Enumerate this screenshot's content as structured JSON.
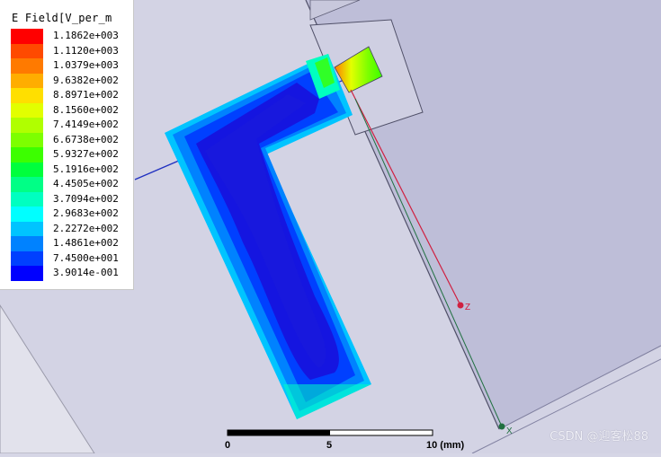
{
  "legend": {
    "title": "E Field[V_per_m",
    "entries": [
      {
        "label": "1.1862e+003",
        "color": "#ff0000"
      },
      {
        "label": "1.1120e+003",
        "color": "#ff4a00"
      },
      {
        "label": "1.0379e+003",
        "color": "#ff7a00"
      },
      {
        "label": "9.6382e+002",
        "color": "#ffad00"
      },
      {
        "label": "8.8971e+002",
        "color": "#ffdf00"
      },
      {
        "label": "8.1560e+002",
        "color": "#e2ff00"
      },
      {
        "label": "7.4149e+002",
        "color": "#b0ff00"
      },
      {
        "label": "6.6738e+002",
        "color": "#7dff00"
      },
      {
        "label": "5.9327e+002",
        "color": "#3cff00"
      },
      {
        "label": "5.1916e+002",
        "color": "#00ff3c"
      },
      {
        "label": "4.4505e+002",
        "color": "#00ff86"
      },
      {
        "label": "3.7094e+002",
        "color": "#00ffc0"
      },
      {
        "label": "2.9683e+002",
        "color": "#00ffff"
      },
      {
        "label": "2.2272e+002",
        "color": "#00c4ff"
      },
      {
        "label": "1.4861e+002",
        "color": "#0082ff"
      },
      {
        "label": "7.4500e+001",
        "color": "#0040ff"
      },
      {
        "label": "3.9014e-001",
        "color": "#0000ff"
      }
    ]
  },
  "scale": {
    "labels": [
      "0",
      "5",
      "10 (mm)"
    ]
  },
  "axes": {
    "z_label": "Z",
    "x_label": "X",
    "z_color": "#d02040",
    "x_color": "#207040"
  },
  "watermark": "CSDN @迎客松88"
}
